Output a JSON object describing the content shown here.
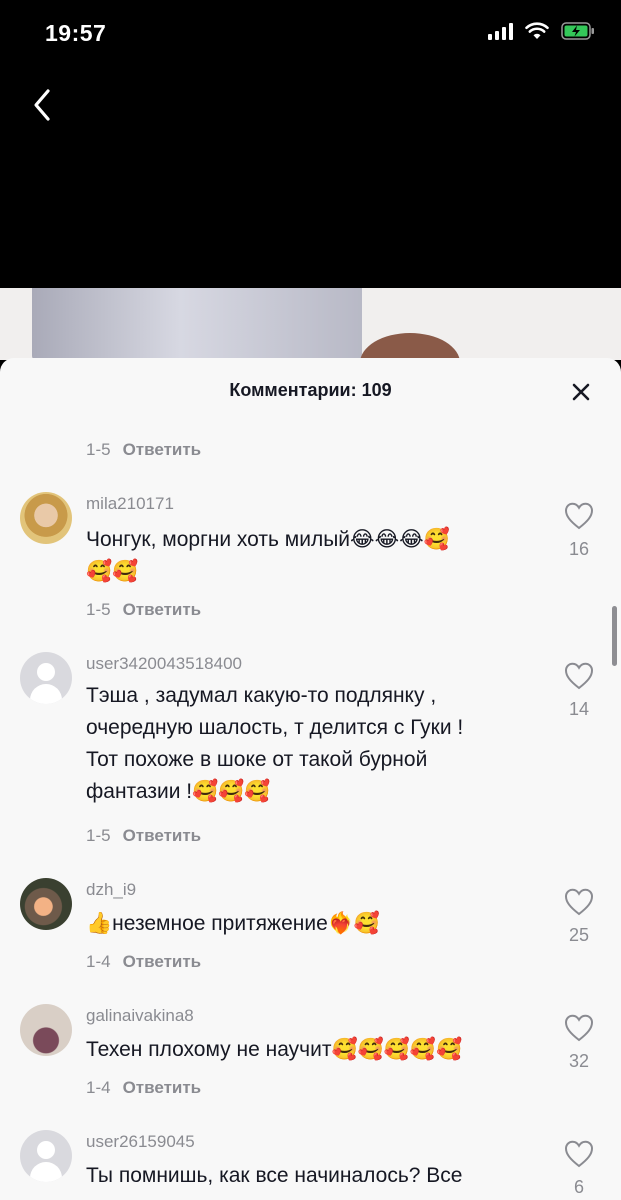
{
  "status": {
    "time": "19:57"
  },
  "sheet": {
    "title": "Комментарии: 109"
  },
  "top_reply": {
    "time": "1-5",
    "reply": "Ответить"
  },
  "comments": [
    {
      "username": "mila210171",
      "lines": [
        "Чонгук, моргни хоть милый😂😂😂🥰",
        "🥰🥰"
      ],
      "time": "1-5",
      "reply": "Ответить",
      "likes": "16"
    },
    {
      "username": "user3420043518400",
      "lines": [
        "Тэша , задумал какую-то подлянку ,",
        "очередную шалость, т делится с Гуки !",
        "Тот похоже в шоке от такой бурной",
        "фантазии !🥰🥰🥰"
      ],
      "time": "1-5",
      "reply": "Ответить",
      "likes": "14"
    },
    {
      "username": "dzh_i9",
      "lines": [
        "👍неземное притяжение❤️‍🔥🥰"
      ],
      "time": "1-4",
      "reply": "Ответить",
      "likes": "25"
    },
    {
      "username": "galinaivakina8",
      "lines": [
        "Техен плохому не научит🥰🥰🥰🥰🥰"
      ],
      "time": "1-4",
      "reply": "Ответить",
      "likes": "32"
    },
    {
      "username": "user26159045",
      "lines": [
        "Ты помнишь, как все начиналось? Все"
      ],
      "likes": "6"
    }
  ],
  "icons": {
    "back": "chevron-left-icon",
    "close": "close-icon",
    "like": "heart-outline-icon",
    "signal": "cellular-signal-icon",
    "wifi": "wifi-icon",
    "battery": "battery-charging-icon"
  }
}
